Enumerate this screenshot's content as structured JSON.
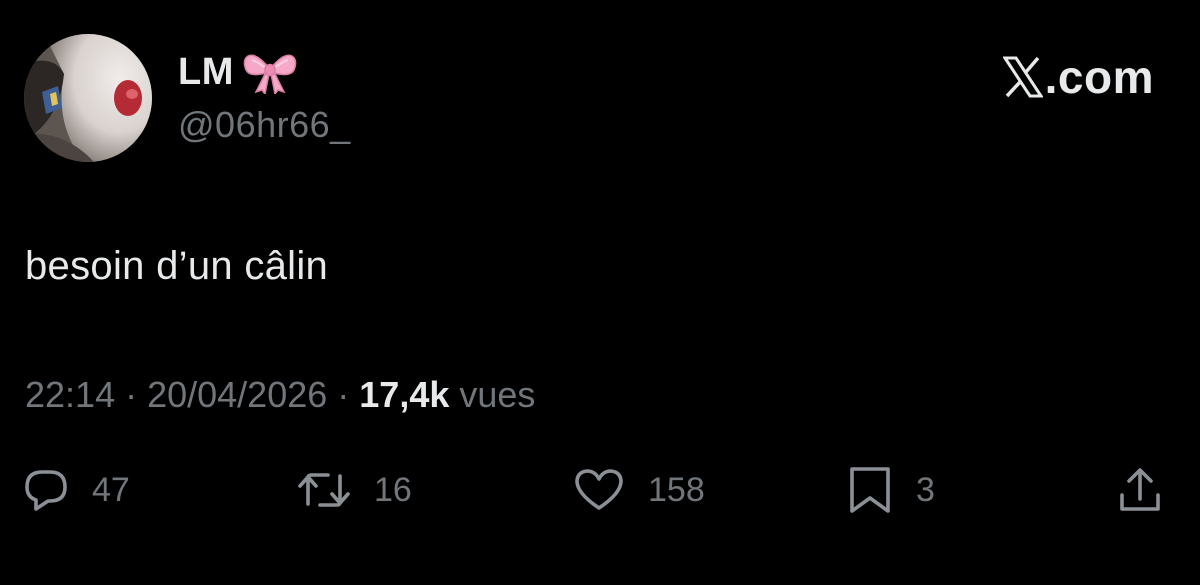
{
  "author": {
    "display_name": "LM",
    "handle": "@06hr66_"
  },
  "brand": {
    "domain": ".com"
  },
  "tweet": {
    "text": "besoin d’un câlin"
  },
  "meta": {
    "time": "22:14",
    "date": "20/04/2026",
    "views_count": "17,4k",
    "views_label": "vues",
    "separator": "·"
  },
  "actions": {
    "replies": "47",
    "reposts": "16",
    "likes": "158",
    "bookmarks": "3"
  },
  "icons": {
    "bow": "pink-ribbon-bow-icon",
    "x_logo": "x-logo-icon",
    "reply": "reply-bubble-icon",
    "repost": "repost-arrows-icon",
    "like": "heart-icon",
    "bookmark": "bookmark-icon",
    "share": "share-upload-icon"
  },
  "colors": {
    "background": "#000000",
    "primary_text": "#e7e9ea",
    "secondary_text": "#71767b",
    "bow": "#f6a8c8"
  }
}
